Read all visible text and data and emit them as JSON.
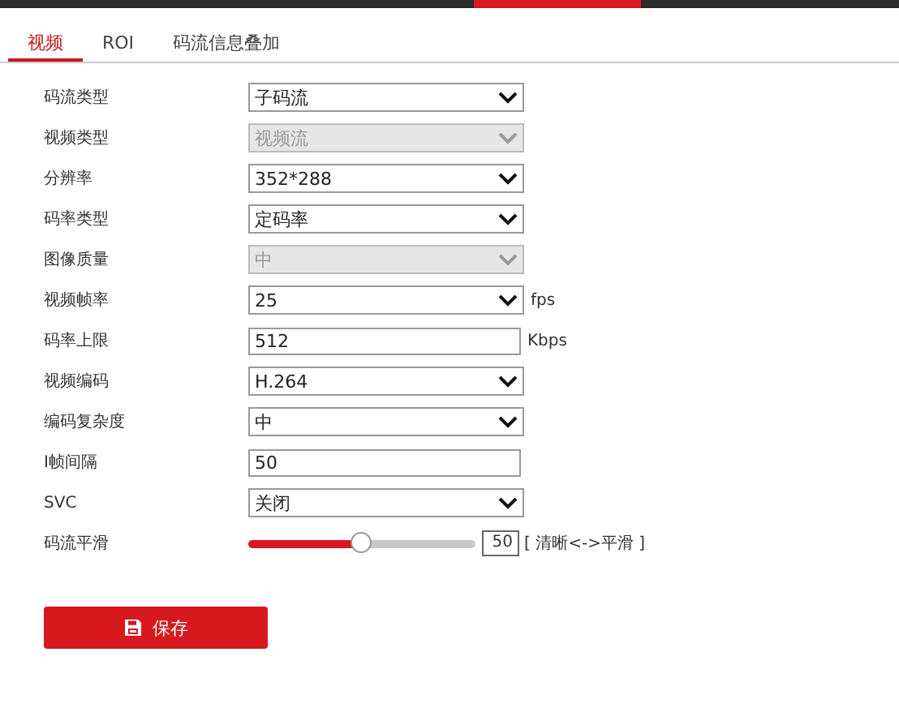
{
  "tabs": [
    {
      "label": "视频",
      "selected": true
    },
    {
      "label": "ROI",
      "selected": false
    },
    {
      "label": "码流信息叠加",
      "selected": false
    }
  ],
  "fields": [
    {
      "kind": "select",
      "label": "码流类型",
      "value": "子码流",
      "disabled": false
    },
    {
      "kind": "select",
      "label": "视频类型",
      "value": "视频流",
      "disabled": true
    },
    {
      "kind": "select",
      "label": "分辨率",
      "value": "352*288",
      "disabled": false
    },
    {
      "kind": "select",
      "label": "码率类型",
      "value": "定码率",
      "disabled": false
    },
    {
      "kind": "select",
      "label": "图像质量",
      "value": "中",
      "disabled": true
    },
    {
      "kind": "select",
      "label": "视频帧率",
      "value": "25",
      "disabled": false,
      "unit": "fps"
    },
    {
      "kind": "input",
      "label": "码率上限",
      "value": "512",
      "unit": "Kbps"
    },
    {
      "kind": "select",
      "label": "视频编码",
      "value": "H.264",
      "disabled": false
    },
    {
      "kind": "select",
      "label": "编码复杂度",
      "value": "中",
      "disabled": false
    },
    {
      "kind": "input",
      "label": "I帧间隔",
      "value": "50"
    },
    {
      "kind": "select",
      "label": "SVC",
      "value": "关闭",
      "disabled": false
    },
    {
      "kind": "slider",
      "label": "码流平滑",
      "level": 0.5,
      "value": "50",
      "hint": "[ 清晰<->平滑 ]"
    }
  ],
  "save_button": {
    "label": "保存"
  }
}
